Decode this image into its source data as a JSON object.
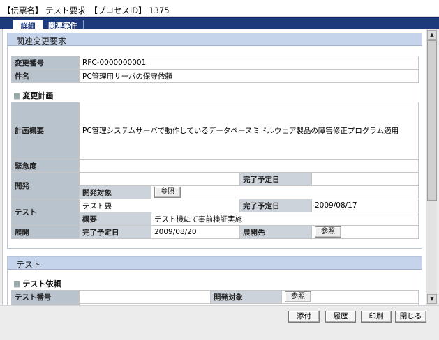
{
  "header": {
    "text": "【伝票名】 テスト要求　【プロセスID】 1375"
  },
  "tabs": [
    {
      "label": "詳細"
    },
    {
      "label": "関連案件"
    }
  ],
  "related_change": {
    "section_title": "関連変更要求",
    "rows": [
      {
        "label": "変更番号",
        "value": "RFC-0000000001"
      },
      {
        "label": "件名",
        "value": "PC管理用サーバの保守依頼"
      }
    ]
  },
  "change_plan": {
    "title": "変更計画",
    "overview_label": "計画概要",
    "overview_value": "PC管理システムサーバで動作しているデータベースミドルウェア製品の障害修正プログラム適用",
    "urgency_label": "緊急度",
    "urgency_value": "",
    "dev_label": "開発",
    "dev_due_label": "完了予定日",
    "dev_due_value": "",
    "dev_target_label": "開発対象",
    "dev_ref_button": "参照",
    "test_label": "テスト",
    "test_required": "テスト要",
    "test_due_label": "完了予定日",
    "test_due_value": "2009/08/17",
    "test_summary_label": "概要",
    "test_summary_value": "テスト機にて事前検証実施",
    "deploy_label": "展開",
    "deploy_due_label": "完了予定日",
    "deploy_due_value": "2009/08/20",
    "deploy_target_label": "展開先",
    "deploy_ref_button": "参照"
  },
  "test_section": {
    "section_title": "テスト",
    "request_title": "テスト依頼",
    "test_no_label": "テスト番号",
    "test_no_value": "",
    "dev_target_label": "開発対象",
    "ref_button": "参照"
  },
  "footer": {
    "attach": "添付",
    "history": "履歴",
    "print": "印刷",
    "close": "閉じる"
  }
}
